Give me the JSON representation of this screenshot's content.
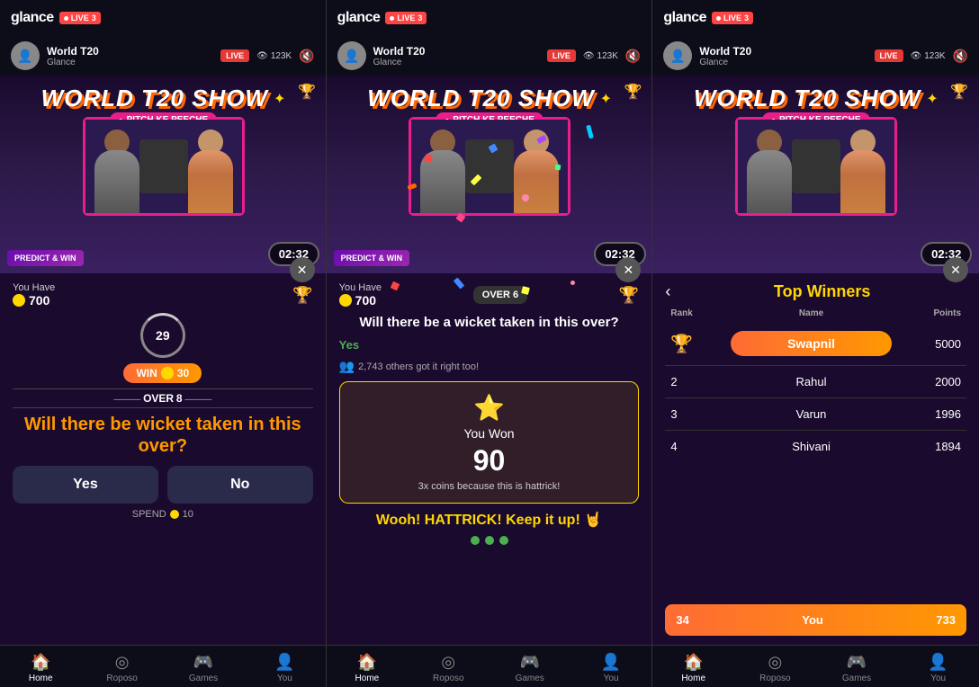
{
  "app": {
    "name": "glance",
    "live_label": "LIVE",
    "live_count": "3"
  },
  "panels": [
    {
      "id": "panel1",
      "channel": {
        "name": "World T20",
        "sub": "Glance",
        "live": "LIVE",
        "views": "123K"
      },
      "show_title_line1": "WORLD T20 SHOW",
      "timer_overlay": "02:32",
      "predict_banner": "PREDICT & WIN",
      "bottom": {
        "timer_value": "29",
        "you_have_label": "You Have",
        "coins": "700",
        "win_label": "WIN",
        "win_amount": "30",
        "over_label": "OVER",
        "over_num": "8",
        "question": "Will there be wicket taken in this over?",
        "yes_label": "Yes",
        "no_label": "No",
        "spend_label": "SPEND",
        "spend_coin": "10"
      }
    },
    {
      "id": "panel2",
      "channel": {
        "name": "World T20",
        "sub": "Glance",
        "live": "LIVE",
        "views": "123K"
      },
      "show_title_line1": "WORLD T20 SHOW",
      "timer_overlay": "02:32",
      "predict_banner": "PREDICT & WIN",
      "bottom": {
        "you_have_label": "You Have",
        "coins": "700",
        "over_label": "OVER",
        "over_num": "6",
        "question": "Will there be a wicket taken in this over?",
        "answer_label": "Yes",
        "others_text": "2,743 others got it right too!",
        "you_won_label": "You Won",
        "you_won_amount": "90",
        "you_won_sub": "3x coins because this is hattrick!",
        "hattrick_text": "Wooh! HATTRICK! Keep it up! 🤘"
      }
    },
    {
      "id": "panel3",
      "channel": {
        "name": "World T20",
        "sub": "Glance",
        "live": "LIVE",
        "views": "123K"
      },
      "show_title_line1": "WORLD T20 SHOW",
      "timer_overlay": "02:32",
      "bottom": {
        "title": "Top Winners",
        "col_rank": "Rank",
        "col_name": "Name",
        "col_points": "Points",
        "rows": [
          {
            "rank": "1",
            "name": "Swapnil",
            "points": "5000",
            "highlight": true,
            "is_rank1": true
          },
          {
            "rank": "2",
            "name": "Rahul",
            "points": "2000",
            "highlight": false
          },
          {
            "rank": "3",
            "name": "Varun",
            "points": "1996",
            "highlight": false
          },
          {
            "rank": "4",
            "name": "Shivani",
            "points": "1894",
            "highlight": false
          },
          {
            "rank": "34",
            "name": "You",
            "points": "733",
            "highlight": true,
            "is_you": true
          }
        ]
      }
    }
  ],
  "nav": {
    "items": [
      {
        "label": "Home",
        "icon": "🏠",
        "active": true
      },
      {
        "label": "Roposo",
        "icon": "◎",
        "active": false
      },
      {
        "label": "Games",
        "icon": "🎮",
        "active": false
      },
      {
        "label": "You",
        "icon": "👤",
        "active": false
      }
    ]
  }
}
